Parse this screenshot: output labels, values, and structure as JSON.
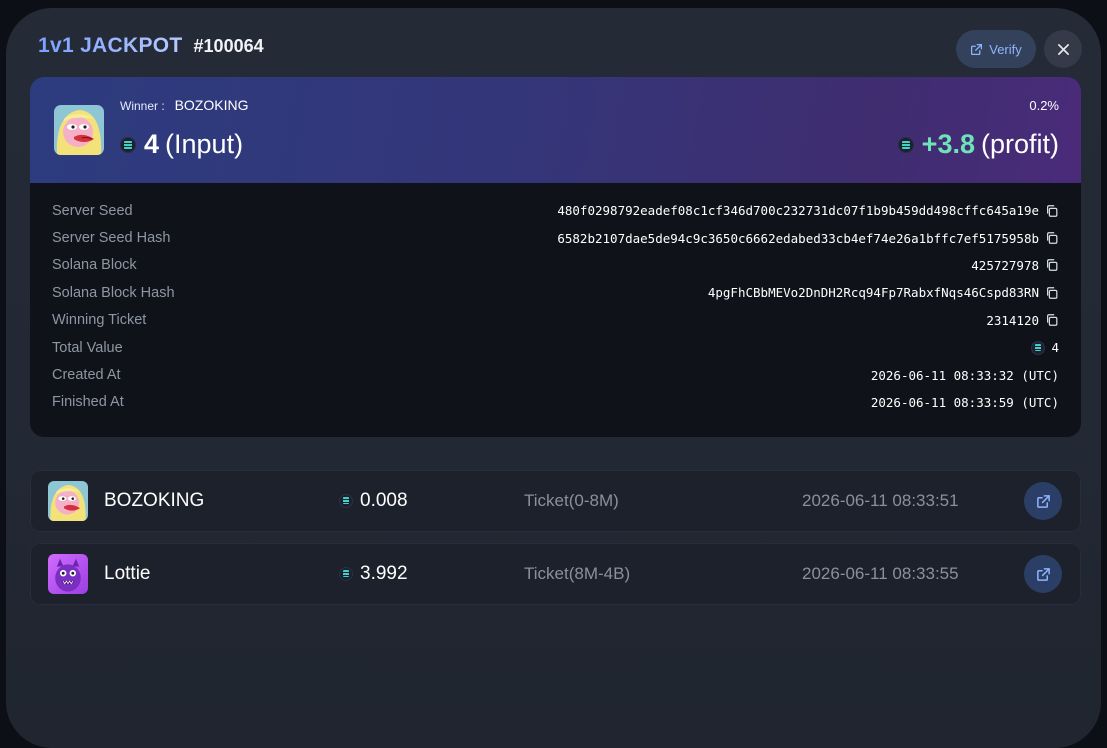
{
  "header": {
    "game_title": "1v1 JACKPOT",
    "round_id": "#100064",
    "verify_label": "Verify"
  },
  "winner": {
    "label": "Winner :",
    "name": "BOZOKING",
    "chance": "0.2%",
    "input_amount": "4",
    "input_label": "(Input)",
    "profit_amount": "+3.8",
    "profit_label": "(profit)"
  },
  "details": [
    {
      "label": "Server Seed",
      "value": "480f0298792eadef08c1cf346d700c232731dc07f1b9b459dd498cffc645a19e",
      "copy": true,
      "coin": false
    },
    {
      "label": "Server Seed Hash",
      "value": "6582b2107dae5de94c9c3650c6662edabed33cb4ef74e26a1bffc7ef5175958b",
      "copy": true,
      "coin": false
    },
    {
      "label": "Solana Block",
      "value": "425727978",
      "copy": true,
      "coin": false
    },
    {
      "label": "Solana Block Hash",
      "value": "4pgFhCBbMEVo2DnDH2Rcq94Fp7RabxfNqs46Cspd83RN",
      "copy": true,
      "coin": false
    },
    {
      "label": "Winning Ticket",
      "value": "2314120",
      "copy": true,
      "coin": false
    },
    {
      "label": "Total Value",
      "value": "4",
      "copy": false,
      "coin": true
    },
    {
      "label": "Created At",
      "value": "2026-06-11 08:33:32 (UTC)",
      "copy": false,
      "coin": false
    },
    {
      "label": "Finished At",
      "value": "2026-06-11 08:33:59 (UTC)",
      "copy": false,
      "coin": false
    }
  ],
  "players": [
    {
      "name": "BOZOKING",
      "amount": "0.008",
      "ticket": "Ticket(0-8M)",
      "time": "2026-06-11 08:33:51",
      "avatar": "bozoking-avatar"
    },
    {
      "name": "Lottie",
      "amount": "3.992",
      "ticket": "Ticket(8M-4B)",
      "time": "2026-06-11 08:33:55",
      "avatar": "lottie-avatar"
    }
  ],
  "colors": {
    "accent_blue": "#8fb3ff",
    "profit_green": "#6fe3b8",
    "winner_gradient_start": "#2c3c7e",
    "winner_gradient_end": "#4a2b7a"
  },
  "icons": {
    "verify": "external-link-icon",
    "close": "close-icon",
    "copy": "copy-icon",
    "coin": "solana-coin-icon",
    "player_link": "external-link-icon"
  }
}
